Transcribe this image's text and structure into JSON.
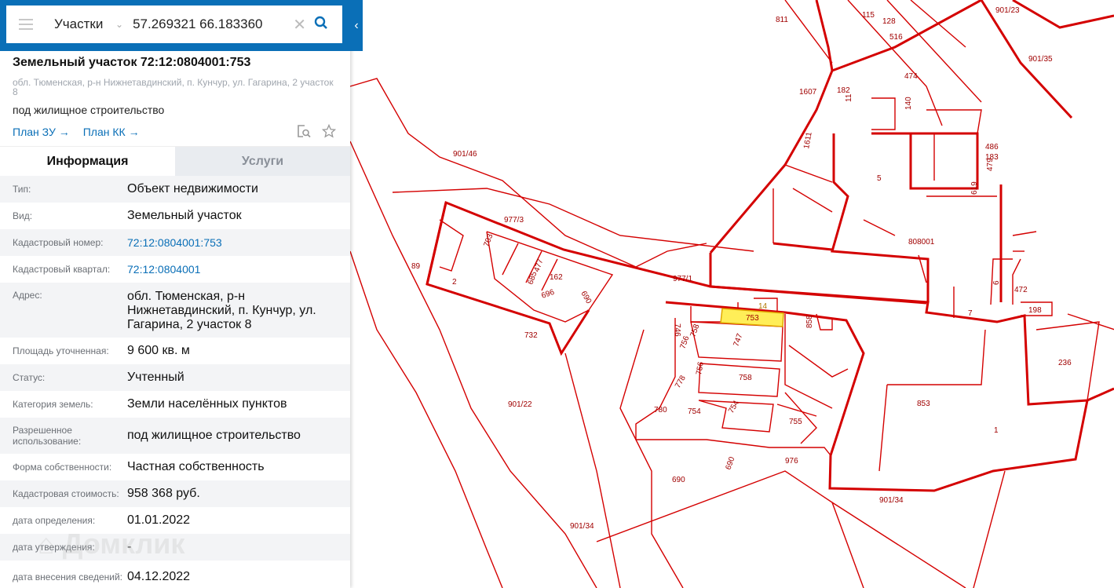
{
  "search": {
    "mode": "Участки",
    "query": "57.269321 66.183360"
  },
  "parcel": {
    "title": "Земельный участок 72:12:0804001:753",
    "address": "обл. Тюменская, р-н Нижнетавдинский, п. Кунчур, ул. Гагарина, 2 участок 8",
    "purpose": "под жилищное строительство",
    "link_plan_zu": "План ЗУ",
    "link_plan_kk": "План КК"
  },
  "tabs": [
    {
      "label": "Информация",
      "active": true
    },
    {
      "label": "Услуги",
      "active": false
    }
  ],
  "info": [
    {
      "key": "Тип:",
      "value": "Объект недвижимости"
    },
    {
      "key": "Вид:",
      "value": "Земельный участок"
    },
    {
      "key": "Кадастровый номер:",
      "value": "72:12:0804001:753",
      "link": true
    },
    {
      "key": "Кадастровый квартал:",
      "value": "72:12:0804001",
      "link": true
    },
    {
      "key": "Адрес:",
      "value": "обл. Тюменская, р-н Нижнетавдинский, п. Кунчур, ул. Гагарина, 2 участок 8"
    },
    {
      "key": "Площадь уточненная:",
      "value": "9 600 кв. м"
    },
    {
      "key": "Статус:",
      "value": "Учтенный"
    },
    {
      "key": "Категория земель:",
      "value": "Земли населённых пунктов"
    },
    {
      "key": "Разрешенное использование:",
      "value": "под жилищное строительство"
    },
    {
      "key": "Форма собственности:",
      "value": "Частная собственность"
    },
    {
      "key": "Кадастровая стоимость:",
      "value": "958 368 руб."
    },
    {
      "key": "дата определения:",
      "value": "01.01.2022"
    },
    {
      "key": "дата утверждения:",
      "value": "-"
    },
    {
      "key": "дата внесения сведений:",
      "value": "04.12.2022"
    }
  ],
  "watermark": "Домклик",
  "map": {
    "line_color": "#d40000",
    "highlight_color": "#ffee58",
    "labels": [
      "901/23",
      "811",
      "115",
      "128",
      "516",
      "901/35",
      "1607",
      "182",
      "11",
      "474",
      "140",
      "901/46",
      "1611",
      "5",
      "486",
      "183",
      "479",
      "619",
      "977/3",
      "703",
      "89",
      "477",
      "162",
      "685",
      "696",
      "2",
      "690",
      "977/1",
      "808001",
      "6",
      "472",
      "14",
      "753",
      "858",
      "198",
      "7",
      "746",
      "758",
      "747",
      "756",
      "758",
      "756",
      "236",
      "732",
      "901/22",
      "778",
      "754",
      "754",
      "755",
      "853",
      "780",
      "1",
      "690",
      "690",
      "976",
      "901/34",
      "901/34"
    ]
  }
}
